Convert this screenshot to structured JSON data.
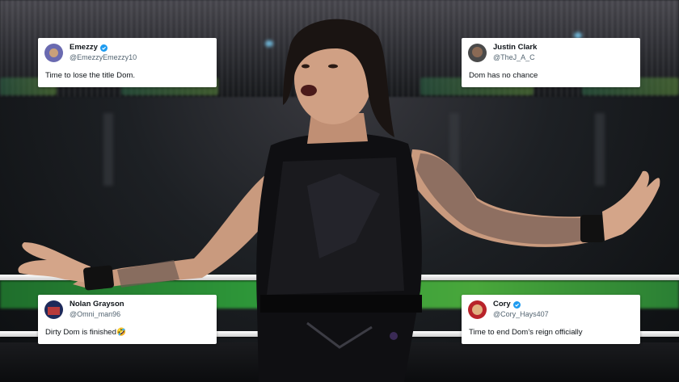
{
  "tweets": [
    {
      "name": "Emezzy",
      "handle": "@EmezzyEmezzy10",
      "verified": true,
      "text": "Time to lose the title Dom.",
      "avatar_color": "#6a6ab0"
    },
    {
      "name": "Justin Clark",
      "handle": "@TheJ_A_C",
      "verified": false,
      "text": "Dom has no chance",
      "avatar_color": "#4a4a4a"
    },
    {
      "name": "Nolan Grayson",
      "handle": "@Omni_man96",
      "verified": false,
      "text": "Dirty Dom is finished🤣",
      "avatar_color": "#1e2a5a"
    },
    {
      "name": "Cory",
      "handle": "@Cory_Hays407",
      "verified": true,
      "text": "Time to end Dom’s reign officially",
      "avatar_color": "#b8232a"
    }
  ],
  "colors": {
    "verified_blue": "#1d9bf0",
    "ring_green": "#2f9a3a"
  }
}
